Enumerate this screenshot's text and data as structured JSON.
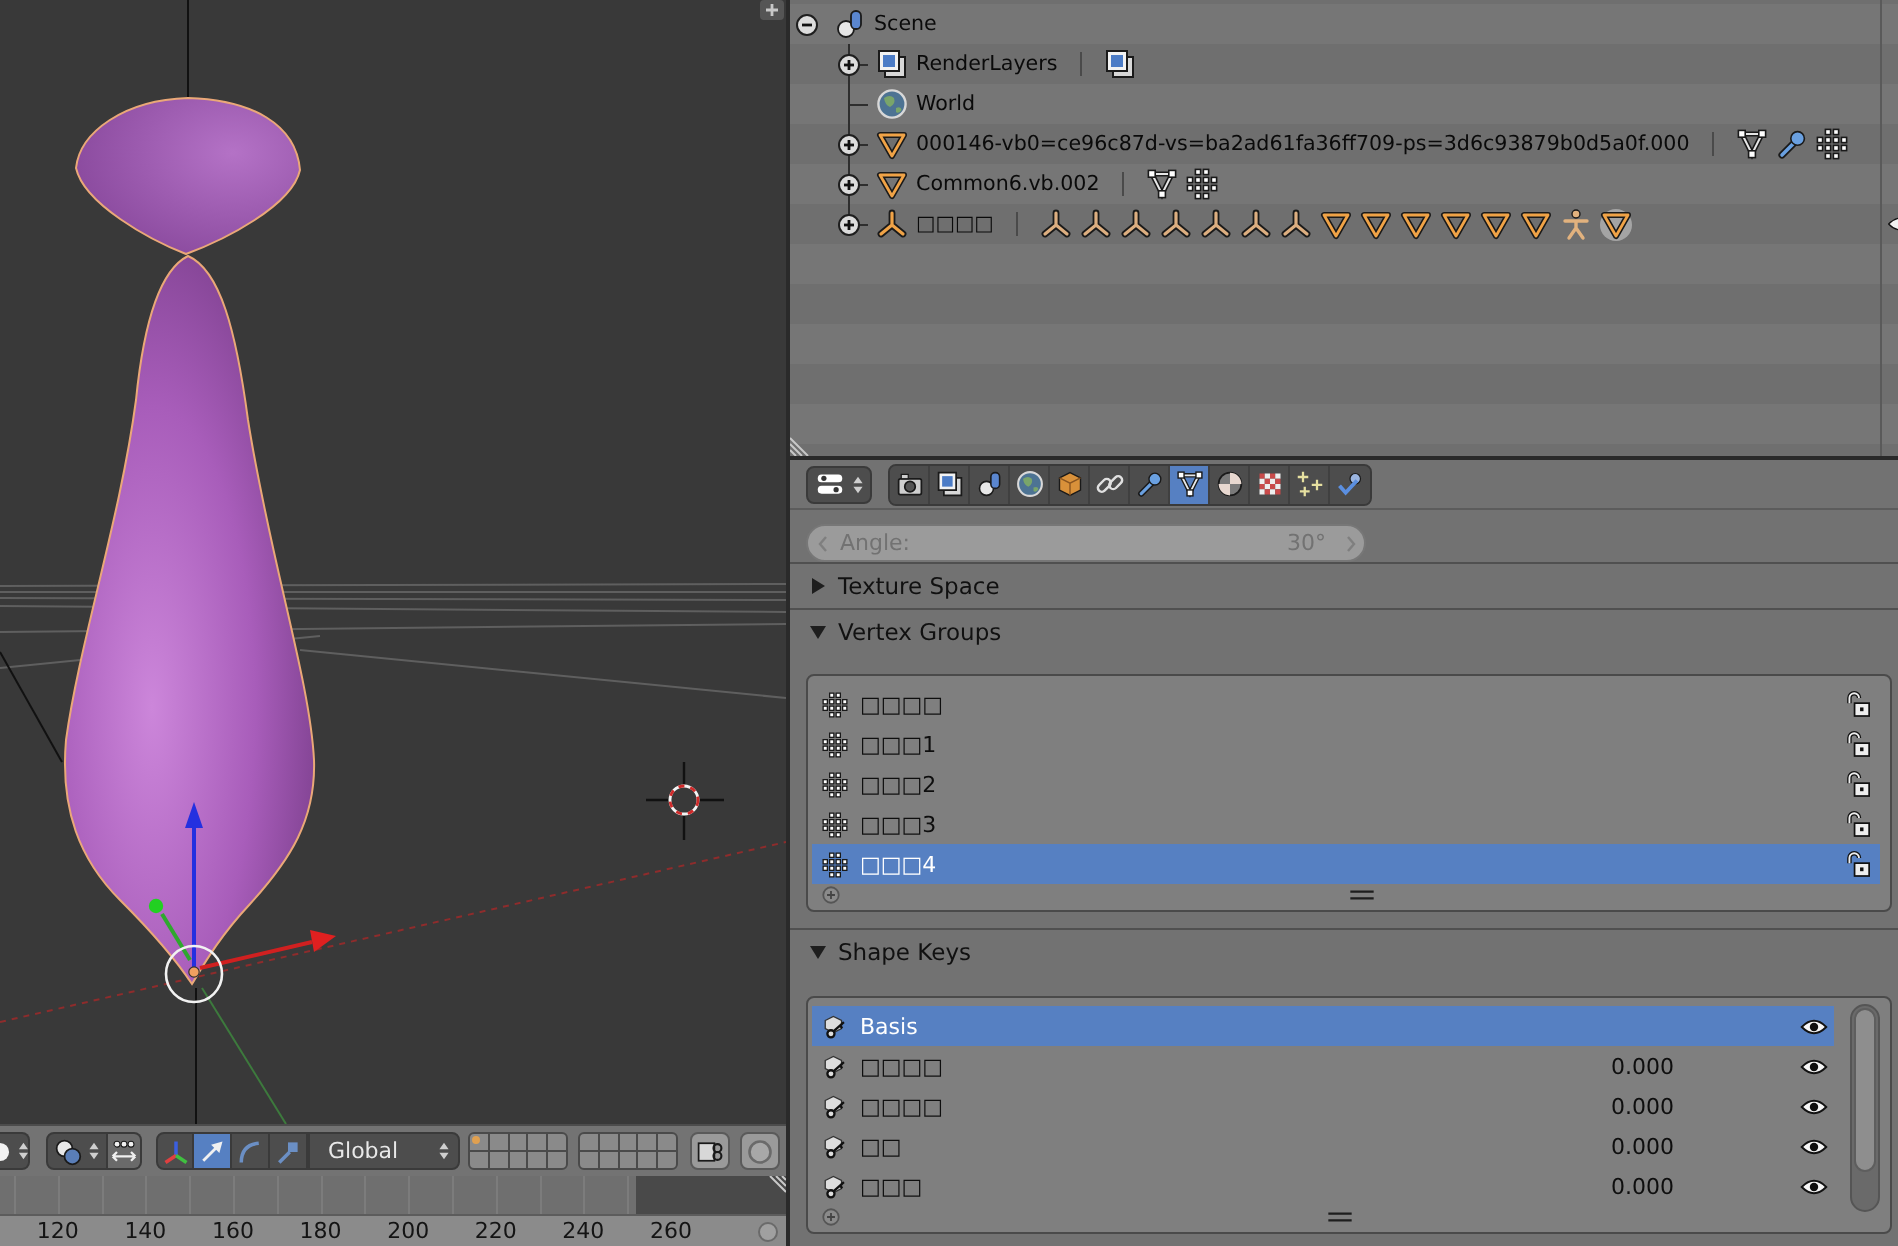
{
  "viewport_header": {
    "manipulators": [
      {
        "kind": "axes",
        "selected": false
      },
      {
        "kind": "translate",
        "selected": true
      },
      {
        "kind": "rotate",
        "selected": false
      },
      {
        "kind": "scale",
        "selected": false
      }
    ],
    "orientation": "Global",
    "layers": [
      {
        "occupied": true
      },
      {
        "occupied": false
      },
      {
        "occupied": false
      },
      {
        "occupied": false
      },
      {
        "occupied": false
      },
      {
        "occupied": false
      },
      {
        "occupied": false
      },
      {
        "occupied": false
      },
      {
        "occupied": false
      },
      {
        "occupied": false
      },
      {
        "occupied": false
      },
      {
        "occupied": false
      },
      {
        "occupied": false
      },
      {
        "occupied": false
      },
      {
        "occupied": false
      },
      {
        "occupied": false
      },
      {
        "occupied": false
      },
      {
        "occupied": false
      },
      {
        "occupied": false
      },
      {
        "occupied": false
      }
    ]
  },
  "timeline": {
    "ruler_labels": [
      "120",
      "140",
      "160",
      "180",
      "200",
      "220",
      "240",
      "260"
    ]
  },
  "outliner": {
    "tree": [
      {
        "name": "Scene",
        "kind": "scene",
        "expanded": true,
        "children": [
          {
            "name": "RenderLayers",
            "kind": "render_layers",
            "expanded": false,
            "contents": [
              {
                "kind": "render_layers",
                "selected": false
              }
            ]
          },
          {
            "name": "World",
            "kind": "world"
          },
          {
            "name": "000146-vb0=ce96c87d-vs=ba2ad61fa36ff709-ps=3d6c93879b0d5a0f.000",
            "kind": "mesh_object",
            "expanded": false,
            "contents": [
              {
                "kind": "mesh_data",
                "selected": false
              },
              {
                "kind": "modifier",
                "selected": false
              },
              {
                "kind": "vertex_groups",
                "selected": false
              }
            ]
          },
          {
            "name": "Common6.vb.002",
            "kind": "mesh_object",
            "expanded": false,
            "contents": [
              {
                "kind": "mesh_data",
                "selected": false
              },
              {
                "kind": "vertex_groups",
                "selected": false
              }
            ]
          },
          {
            "name": "□□□□",
            "kind": "armature",
            "expanded": false,
            "contents": [
              {
                "kind": "bone",
                "selected": false
              },
              {
                "kind": "bone",
                "selected": false
              },
              {
                "kind": "bone",
                "selected": false
              },
              {
                "kind": "bone",
                "selected": false
              },
              {
                "kind": "bone",
                "selected": false
              },
              {
                "kind": "bone",
                "selected": false
              },
              {
                "kind": "bone",
                "selected": false
              },
              {
                "kind": "mesh_object",
                "selected": false
              },
              {
                "kind": "mesh_object",
                "selected": false
              },
              {
                "kind": "mesh_object",
                "selected": false
              },
              {
                "kind": "mesh_object",
                "selected": false
              },
              {
                "kind": "mesh_object",
                "selected": false
              },
              {
                "kind": "mesh_object",
                "selected": false
              },
              {
                "kind": "pose",
                "selected": false
              },
              {
                "kind": "mesh_object",
                "selected": true
              }
            ]
          }
        ]
      }
    ]
  },
  "properties": {
    "tabs": [
      {
        "kind": "render",
        "selected": false
      },
      {
        "kind": "render_layers",
        "selected": false
      },
      {
        "kind": "scene",
        "selected": false
      },
      {
        "kind": "world",
        "selected": false
      },
      {
        "kind": "object",
        "selected": false
      },
      {
        "kind": "constraints",
        "selected": false
      },
      {
        "kind": "modifiers",
        "selected": false
      },
      {
        "kind": "data",
        "selected": true
      },
      {
        "kind": "material",
        "selected": false
      },
      {
        "kind": "texture",
        "selected": false
      },
      {
        "kind": "particles",
        "selected": false
      },
      {
        "kind": "physics",
        "selected": false
      }
    ],
    "angle_field": {
      "label": "Angle:",
      "value": "30°",
      "disabled": true
    },
    "panels": [
      {
        "title": "Texture Space",
        "kind": "texture_space",
        "expanded": false
      },
      {
        "title": "Vertex Groups",
        "kind": "vertex_groups",
        "expanded": true,
        "items": [
          {
            "name": "□□□□",
            "selected": false,
            "locked": false
          },
          {
            "name": "□□□1",
            "selected": false,
            "locked": false
          },
          {
            "name": "□□□2",
            "selected": false,
            "locked": false
          },
          {
            "name": "□□□3",
            "selected": false,
            "locked": false
          },
          {
            "name": "□□□4",
            "selected": true,
            "locked": false
          }
        ]
      },
      {
        "title": "Shape Keys",
        "kind": "shape_keys",
        "expanded": true,
        "items": [
          {
            "name": "Basis",
            "selected": true,
            "visible": true
          },
          {
            "name": "□□□□",
            "value": "0.000",
            "selected": false,
            "visible": true
          },
          {
            "name": "□□□□",
            "value": "0.000",
            "selected": false,
            "visible": true
          },
          {
            "name": "□□",
            "value": "0.000",
            "selected": false,
            "visible": true
          },
          {
            "name": "□□□",
            "value": "0.000",
            "selected": false,
            "visible": true
          }
        ]
      }
    ]
  }
}
